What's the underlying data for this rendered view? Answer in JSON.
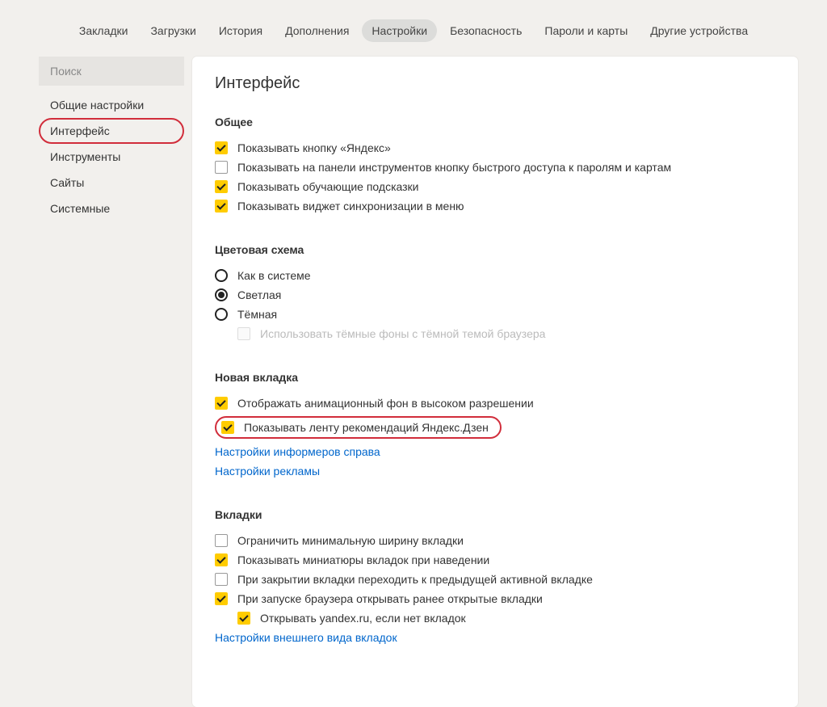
{
  "topnav": {
    "items": [
      {
        "label": "Закладки"
      },
      {
        "label": "Загрузки"
      },
      {
        "label": "История"
      },
      {
        "label": "Дополнения"
      },
      {
        "label": "Настройки",
        "active": true
      },
      {
        "label": "Безопасность"
      },
      {
        "label": "Пароли и карты"
      },
      {
        "label": "Другие устройства"
      }
    ]
  },
  "sidebar": {
    "search_placeholder": "Поиск",
    "items": [
      {
        "label": "Общие настройки"
      },
      {
        "label": "Интерфейс",
        "highlight": true
      },
      {
        "label": "Инструменты"
      },
      {
        "label": "Сайты"
      },
      {
        "label": "Системные"
      }
    ]
  },
  "page": {
    "title": "Интерфейс"
  },
  "sections": {
    "general": {
      "heading": "Общее",
      "opts": [
        {
          "label": "Показывать кнопку «Яндекс»",
          "checked": true
        },
        {
          "label": "Показывать на панели инструментов кнопку быстрого доступа к паролям и картам",
          "checked": false
        },
        {
          "label": "Показывать обучающие подсказки",
          "checked": true
        },
        {
          "label": "Показывать виджет синхронизации в меню",
          "checked": true
        }
      ]
    },
    "theme": {
      "heading": "Цветовая схема",
      "opts": [
        {
          "label": "Как в системе"
        },
        {
          "label": "Светлая",
          "selected": true
        },
        {
          "label": "Тёмная"
        }
      ],
      "dark_bg": {
        "label": "Использовать тёмные фоны с тёмной темой браузера"
      }
    },
    "newtab": {
      "heading": "Новая вкладка",
      "opts": [
        {
          "label": "Отображать анимационный фон в высоком разрешении",
          "checked": true
        },
        {
          "label": "Показывать ленту рекомендаций Яндекс.Дзен",
          "checked": true,
          "highlight": true
        }
      ],
      "links": [
        "Настройки информеров справа",
        "Настройки рекламы"
      ]
    },
    "tabs": {
      "heading": "Вкладки",
      "opts": [
        {
          "label": "Ограничить минимальную ширину вкладки",
          "checked": false
        },
        {
          "label": "Показывать миниатюры вкладок при наведении",
          "checked": true
        },
        {
          "label": "При закрытии вкладки переходить к предыдущей активной вкладке",
          "checked": false
        },
        {
          "label": "При запуске браузера открывать ранее открытые вкладки",
          "checked": true
        }
      ],
      "sub": {
        "label": "Открывать yandex.ru, если нет вкладок",
        "checked": true
      },
      "links": [
        "Настройки внешнего вида вкладок"
      ]
    }
  }
}
